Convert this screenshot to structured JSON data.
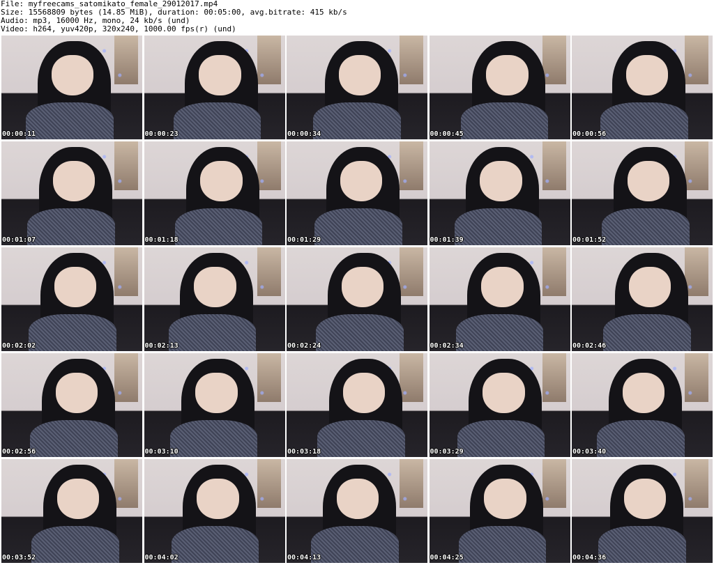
{
  "header": {
    "file": "File: myfreecams_satomikato_female_29012017.mp4",
    "size": "Size: 15568809 bytes (14.85 MiB), duration: 00:05:00, avg.bitrate: 415 kb/s",
    "audio": "Audio: mp3, 16000 Hz, mono, 24 kb/s (und)",
    "video": "Video: h264, yuv420p, 320x240, 1000.00 fps(r) (und)"
  },
  "thumbnails": [
    {
      "timestamp": "00:00:11"
    },
    {
      "timestamp": "00:00:23"
    },
    {
      "timestamp": "00:00:34"
    },
    {
      "timestamp": "00:00:45"
    },
    {
      "timestamp": "00:00:56"
    },
    {
      "timestamp": "00:01:07"
    },
    {
      "timestamp": "00:01:18"
    },
    {
      "timestamp": "00:01:29"
    },
    {
      "timestamp": "00:01:39"
    },
    {
      "timestamp": "00:01:52"
    },
    {
      "timestamp": "00:02:02"
    },
    {
      "timestamp": "00:02:13"
    },
    {
      "timestamp": "00:02:24"
    },
    {
      "timestamp": "00:02:34"
    },
    {
      "timestamp": "00:02:46"
    },
    {
      "timestamp": "00:02:56"
    },
    {
      "timestamp": "00:03:10"
    },
    {
      "timestamp": "00:03:18"
    },
    {
      "timestamp": "00:03:29"
    },
    {
      "timestamp": "00:03:40"
    },
    {
      "timestamp": "00:03:52"
    },
    {
      "timestamp": "00:04:02"
    },
    {
      "timestamp": "00:04:13"
    },
    {
      "timestamp": "00:04:25"
    },
    {
      "timestamp": "00:04:36"
    }
  ]
}
